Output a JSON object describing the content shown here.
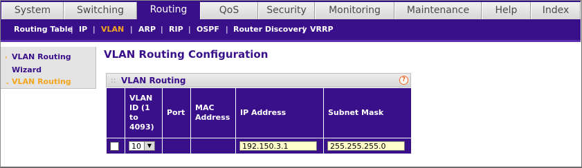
{
  "top_tabs": [
    {
      "label": "System",
      "active": false
    },
    {
      "label": "Switching",
      "active": false
    },
    {
      "label": "Routing",
      "active": true
    },
    {
      "label": "QoS",
      "active": false
    },
    {
      "label": "Security",
      "active": false
    },
    {
      "label": "Monitoring",
      "active": false
    },
    {
      "label": "Maintenance",
      "active": false
    },
    {
      "label": "Help",
      "active": false
    },
    {
      "label": "Index",
      "active": false
    }
  ],
  "sub_nav": [
    {
      "label": "Routing Table",
      "active": false
    },
    {
      "label": "IP",
      "active": false
    },
    {
      "label": "VLAN",
      "active": true
    },
    {
      "label": "ARP",
      "active": false
    },
    {
      "label": "RIP",
      "active": false
    },
    {
      "label": "OSPF",
      "active": false
    },
    {
      "label": "Router Discovery",
      "active": false
    },
    {
      "label": "VRRP",
      "active": false
    }
  ],
  "sub_nav_separator": "|",
  "left_menu": [
    {
      "label": "VLAN Routing Wizard",
      "line1": "VLAN Routing",
      "line2": "Wizard",
      "active": false
    },
    {
      "label": "VLAN Routing",
      "active": true
    }
  ],
  "page_title": "VLAN Routing Configuration",
  "section": {
    "title": "VLAN Routing",
    "help": "?"
  },
  "table": {
    "headers": {
      "select": "",
      "vlan_id": "VLAN ID (1 to 4093)",
      "vlan_id_lines": [
        "VLAN",
        "ID (1",
        "to",
        "4093)"
      ],
      "port": "Port",
      "mac": "MAC Address",
      "mac_lines": [
        "MAC",
        "Address"
      ],
      "ip": "IP Address",
      "mask": "Subnet Mask"
    },
    "rows": [
      {
        "checked": false,
        "vlan_id": "10",
        "port": "",
        "mac": "",
        "ip": "192.150.3.1",
        "mask": "255.255.255.0"
      }
    ]
  },
  "colors": {
    "brand_purple": "#3a0f8a",
    "accent_orange": "#f3a51c",
    "input_yellow": "#ffffcc"
  }
}
